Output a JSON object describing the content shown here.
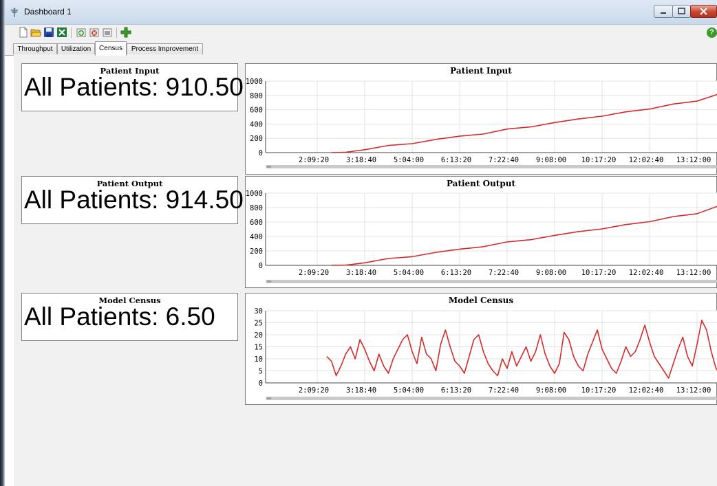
{
  "window": {
    "title": "Dashboard 1",
    "controls": [
      "minimize",
      "maximize",
      "close"
    ],
    "close_color": "#c8452f"
  },
  "toolbar": {
    "icons": [
      "new-file-icon",
      "open-folder-icon",
      "save-icon",
      "excel-export-icon",
      "add-view-icon",
      "remove-view-icon",
      "view-properties-icon",
      "add-chart-icon"
    ],
    "help_label": "?"
  },
  "tabs": [
    {
      "label": "Throughput",
      "active": false
    },
    {
      "label": "Utilization",
      "active": false
    },
    {
      "label": "Census",
      "active": true
    },
    {
      "label": "Process Improvement",
      "active": false
    }
  ],
  "kpis": [
    {
      "title": "Patient Input",
      "value": "All Patients: 910.50"
    },
    {
      "title": "Patient Output",
      "value": "All Patients: 914.50"
    },
    {
      "title": "Model Census",
      "value": "All Patients: 6.50"
    }
  ],
  "chart_data": [
    {
      "type": "line",
      "title": "Patient Input",
      "x_ticks": [
        "2:09:20",
        "3:18:40",
        "5:04:00",
        "6:13:20",
        "7:22:40",
        "9:08:00",
        "10:17:20",
        "12:02:40",
        "13:12:00"
      ],
      "y_ticks": [
        "0",
        "200",
        "400",
        "600",
        "800",
        "1000"
      ],
      "ylim": [
        0,
        1000
      ],
      "grid": true,
      "line_color": "#d42a2a",
      "series": [
        {
          "x": [
            6.3,
            6.6,
            7.0,
            7.5,
            8.0,
            8.5,
            9.0,
            9.5,
            10.0,
            10.5,
            11.0,
            11.5,
            12.0,
            12.5,
            13.0,
            13.5,
            14.0,
            14.5
          ],
          "values": [
            0,
            5,
            40,
            100,
            125,
            185,
            230,
            260,
            330,
            360,
            420,
            470,
            510,
            570,
            610,
            680,
            720,
            830
          ]
        }
      ]
    },
    {
      "type": "line",
      "title": "Patient Output",
      "x_ticks": [
        "2:09:20",
        "3:18:40",
        "5:04:00",
        "6:13:20",
        "7:22:40",
        "9:08:00",
        "10:17:20",
        "12:02:40",
        "13:12:00"
      ],
      "y_ticks": [
        "0",
        "200",
        "400",
        "600",
        "800",
        "1000"
      ],
      "ylim": [
        0,
        1000
      ],
      "grid": true,
      "line_color": "#d42a2a",
      "series": [
        {
          "x": [
            6.3,
            6.6,
            7.0,
            7.5,
            8.0,
            8.5,
            9.0,
            9.5,
            10.0,
            10.5,
            11.0,
            11.5,
            12.0,
            12.5,
            13.0,
            13.5,
            14.0,
            14.5
          ],
          "values": [
            0,
            3,
            35,
            95,
            120,
            180,
            225,
            258,
            325,
            355,
            415,
            468,
            505,
            565,
            605,
            675,
            715,
            835
          ]
        }
      ]
    },
    {
      "type": "line",
      "title": "Model Census",
      "x_ticks": [
        "2:09:20",
        "3:18:40",
        "5:04:00",
        "6:13:20",
        "7:22:40",
        "9:08:00",
        "10:17:20",
        "12:02:40",
        "13:12:00"
      ],
      "y_ticks": [
        "0",
        "5",
        "10",
        "15",
        "20",
        "25",
        "30"
      ],
      "ylim": [
        0,
        30
      ],
      "grid": true,
      "line_color": "#d42a2a",
      "series": [
        {
          "x": [
            6.2,
            6.3,
            6.4,
            6.5,
            6.6,
            6.7,
            6.8,
            6.9,
            7.0,
            7.1,
            7.2,
            7.3,
            7.4,
            7.5,
            7.6,
            7.7,
            7.8,
            7.9,
            8.0,
            8.1,
            8.2,
            8.3,
            8.4,
            8.5,
            8.6,
            8.7,
            8.8,
            8.9,
            9.0,
            9.1,
            9.2,
            9.3,
            9.4,
            9.5,
            9.6,
            9.7,
            9.8,
            9.9,
            10.0,
            10.1,
            10.2,
            10.3,
            10.4,
            10.5,
            10.6,
            10.7,
            10.8,
            10.9,
            11.0,
            11.1,
            11.2,
            11.3,
            11.4,
            11.5,
            11.6,
            11.7,
            11.8,
            11.9,
            12.0,
            12.1,
            12.2,
            12.3,
            12.4,
            12.5,
            12.6,
            12.7,
            12.8,
            12.9,
            13.0,
            13.1,
            13.2,
            13.3,
            13.4,
            13.5,
            13.6,
            13.7,
            13.8,
            13.9,
            14.0,
            14.1,
            14.2,
            14.3,
            14.4,
            14.5,
            14.6
          ],
          "values": [
            11,
            9,
            3,
            7,
            12,
            15,
            10,
            18,
            14,
            9,
            5,
            12,
            7,
            4,
            10,
            14,
            18,
            20,
            13,
            8,
            19,
            12,
            10,
            5,
            16,
            22,
            15,
            9,
            7,
            4,
            11,
            18,
            20,
            13,
            8,
            5,
            3,
            10,
            6,
            13,
            7,
            11,
            15,
            9,
            13,
            20,
            12,
            7,
            4,
            8,
            21,
            18,
            11,
            7,
            5,
            12,
            17,
            22,
            14,
            10,
            6,
            4,
            9,
            15,
            11,
            13,
            18,
            24,
            17,
            11,
            8,
            5,
            2,
            8,
            14,
            19,
            11,
            7,
            16,
            26,
            22,
            13,
            6,
            3,
            2
          ]
        }
      ]
    }
  ]
}
